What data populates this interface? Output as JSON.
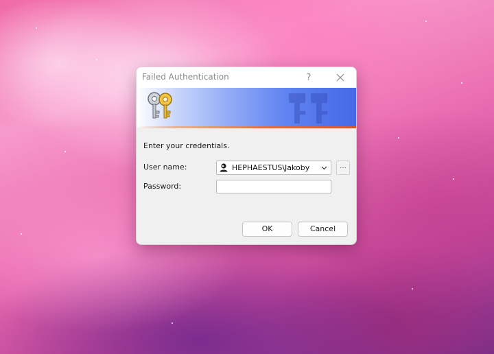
{
  "dialog": {
    "title": "Failed Authentication",
    "help_glyph": "?",
    "prompt": "Enter your credentials.",
    "username_label": "User name:",
    "username_value": "HEPHAESTUS\\Jakoby",
    "browse_label": "...",
    "password_label": "Password:",
    "password_value": "",
    "ok_label": "OK",
    "cancel_label": "Cancel"
  },
  "icons": {
    "help": "question-mark",
    "close": "close-x",
    "banner": "keys",
    "user": "user-account",
    "dropdown": "chevron-down"
  },
  "colors": {
    "banner_blue": "#4668e6",
    "banner_accent_line": "#e06f3a",
    "dialog_background": "#f0f0f0",
    "title_text": "#8a8a8a"
  }
}
